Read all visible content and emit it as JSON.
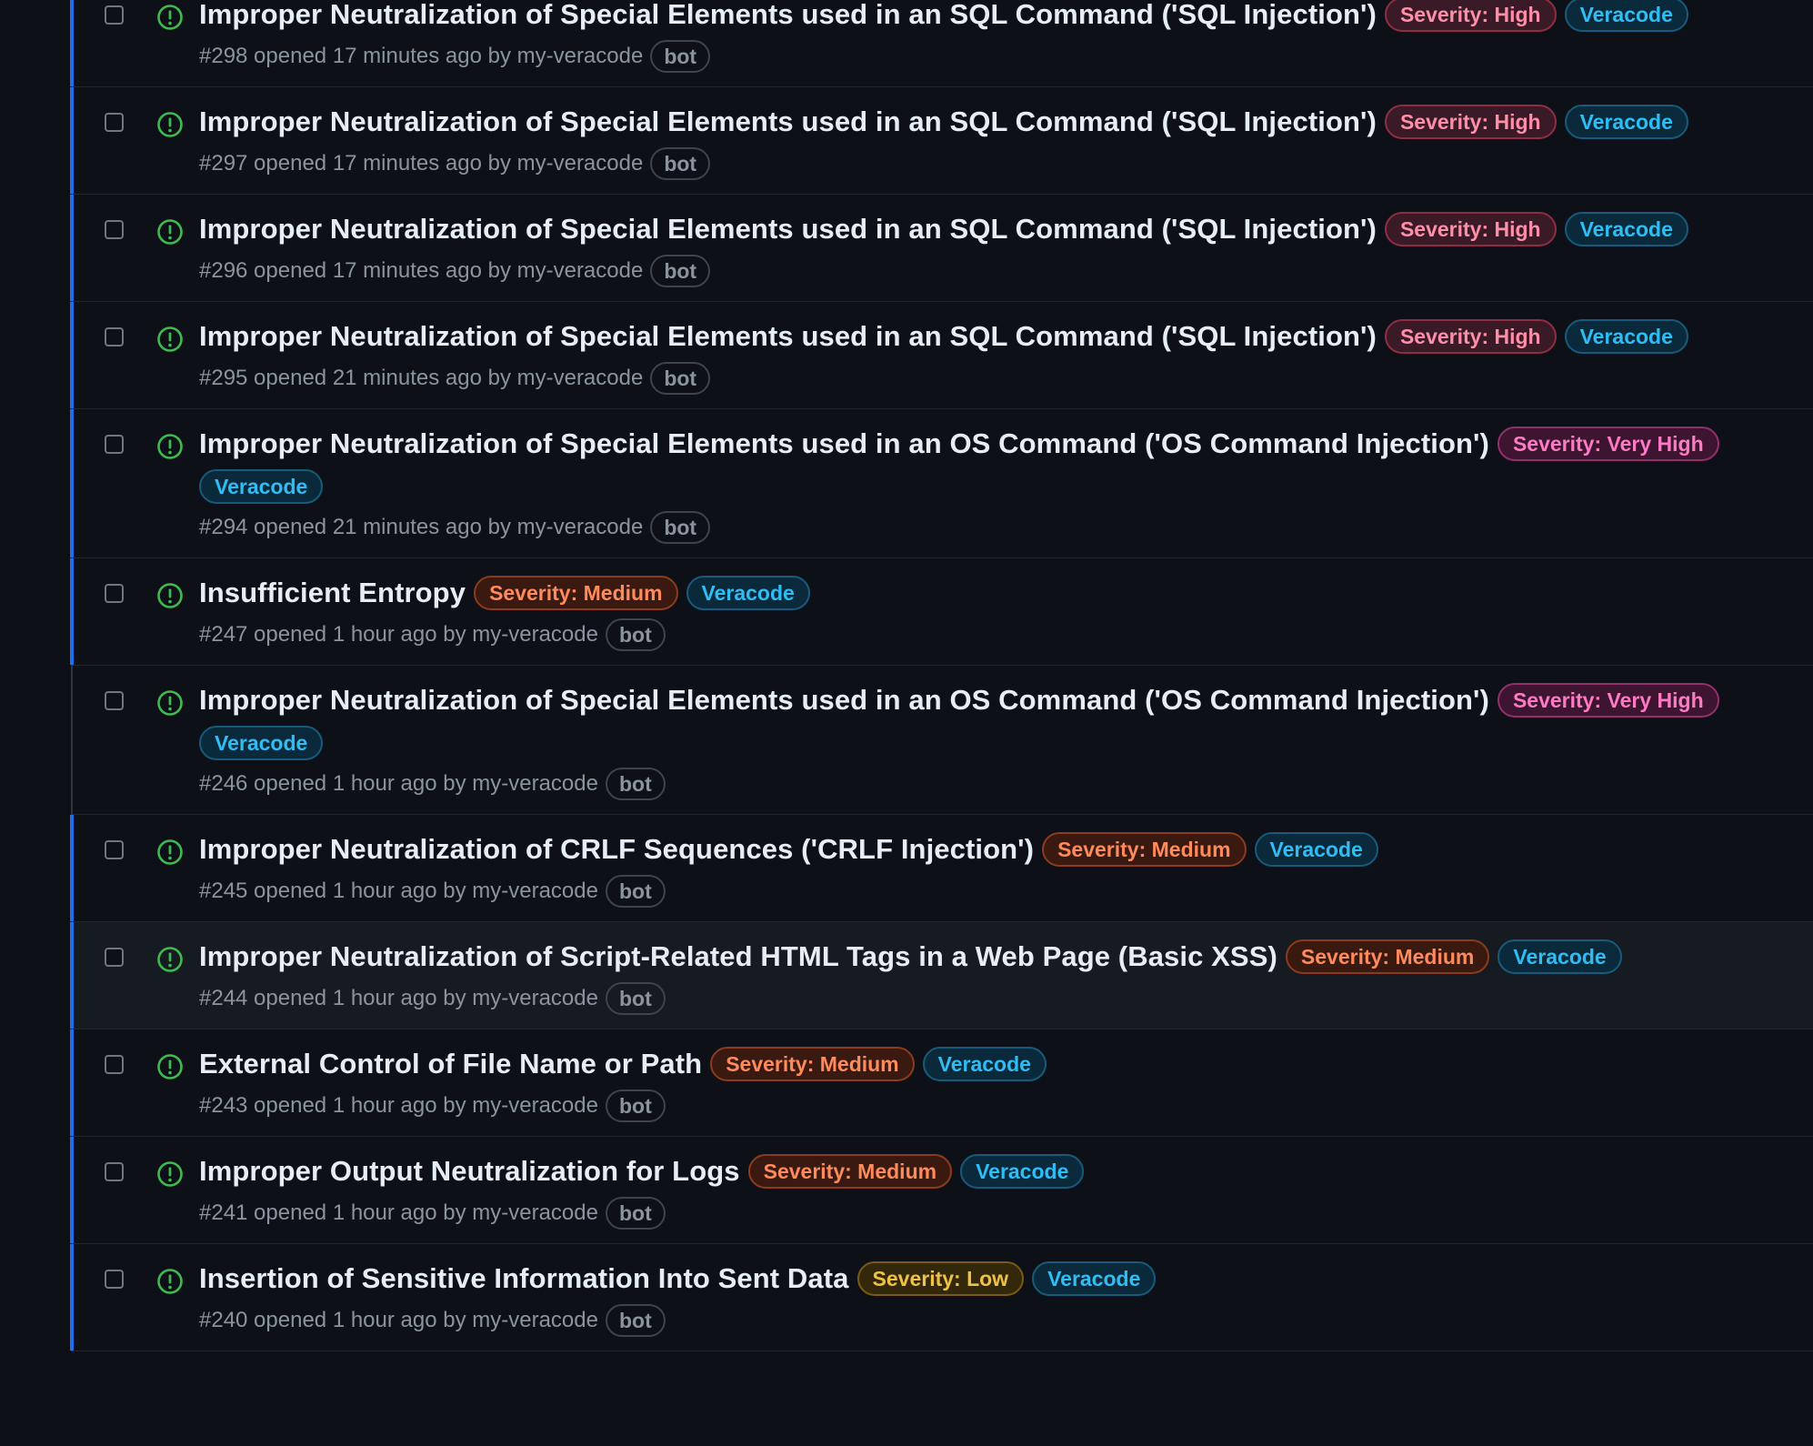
{
  "colors": {
    "background": "#0d1117",
    "open_icon": "#3fb950",
    "active_bar": "#1f6feb",
    "severity_high": "#ff8fa8",
    "severity_very_high": "#ff7ac4",
    "severity_medium": "#ff8a5c",
    "severity_low": "#f0c244",
    "veracode": "#2fbdf4"
  },
  "issues": [
    {
      "title": "Improper Neutralization of Special Elements used in an SQL Command ('SQL Injection')",
      "severity_label": "Severity: High",
      "severity_class": "sev-high",
      "source_label": "Veracode",
      "meta_text": "#298 opened 17 minutes ago by my-veracode",
      "bot_label": "bot",
      "active": true,
      "hover": false
    },
    {
      "title": "Improper Neutralization of Special Elements used in an SQL Command ('SQL Injection')",
      "severity_label": "Severity: High",
      "severity_class": "sev-high",
      "source_label": "Veracode",
      "meta_text": "#297 opened 17 minutes ago by my-veracode",
      "bot_label": "bot",
      "active": true,
      "hover": false
    },
    {
      "title": "Improper Neutralization of Special Elements used in an SQL Command ('SQL Injection')",
      "severity_label": "Severity: High",
      "severity_class": "sev-high",
      "source_label": "Veracode",
      "meta_text": "#296 opened 17 minutes ago by my-veracode",
      "bot_label": "bot",
      "active": true,
      "hover": false
    },
    {
      "title": "Improper Neutralization of Special Elements used in an SQL Command ('SQL Injection')",
      "severity_label": "Severity: High",
      "severity_class": "sev-high",
      "source_label": "Veracode",
      "meta_text": "#295 opened 21 minutes ago by my-veracode",
      "bot_label": "bot",
      "active": true,
      "hover": false
    },
    {
      "title": "Improper Neutralization of Special Elements used in an OS Command ('OS Command Injection')",
      "severity_label": "Severity: Very High",
      "severity_class": "sev-vhigh",
      "source_label": "Veracode",
      "meta_text": "#294 opened 21 minutes ago by my-veracode",
      "bot_label": "bot",
      "active": true,
      "hover": false
    },
    {
      "title": "Insufficient Entropy",
      "severity_label": "Severity: Medium",
      "severity_class": "sev-medium",
      "source_label": "Veracode",
      "meta_text": "#247 opened 1 hour ago by my-veracode",
      "bot_label": "bot",
      "active": true,
      "hover": false
    },
    {
      "title": "Improper Neutralization of Special Elements used in an OS Command ('OS Command Injection')",
      "severity_label": "Severity: Very High",
      "severity_class": "sev-vhigh",
      "source_label": "Veracode",
      "meta_text": "#246 opened 1 hour ago by my-veracode",
      "bot_label": "bot",
      "active": false,
      "hover": false
    },
    {
      "title": "Improper Neutralization of CRLF Sequences ('CRLF Injection')",
      "severity_label": "Severity: Medium",
      "severity_class": "sev-medium",
      "source_label": "Veracode",
      "meta_text": "#245 opened 1 hour ago by my-veracode",
      "bot_label": "bot",
      "active": true,
      "hover": false
    },
    {
      "title": "Improper Neutralization of Script-Related HTML Tags in a Web Page (Basic XSS)",
      "severity_label": "Severity: Medium",
      "severity_class": "sev-medium",
      "source_label": "Veracode",
      "meta_text": "#244 opened 1 hour ago by my-veracode",
      "bot_label": "bot",
      "active": true,
      "hover": true
    },
    {
      "title": "External Control of File Name or Path",
      "severity_label": "Severity: Medium",
      "severity_class": "sev-medium",
      "source_label": "Veracode",
      "meta_text": "#243 opened 1 hour ago by my-veracode",
      "bot_label": "bot",
      "active": true,
      "hover": false
    },
    {
      "title": "Improper Output Neutralization for Logs",
      "severity_label": "Severity: Medium",
      "severity_class": "sev-medium",
      "source_label": "Veracode",
      "meta_text": "#241 opened 1 hour ago by my-veracode",
      "bot_label": "bot",
      "active": true,
      "hover": false
    },
    {
      "title": "Insertion of Sensitive Information Into Sent Data",
      "severity_label": "Severity: Low",
      "severity_class": "sev-low",
      "source_label": "Veracode",
      "meta_text": "#240 opened 1 hour ago by my-veracode",
      "bot_label": "bot",
      "active": true,
      "hover": false
    }
  ]
}
